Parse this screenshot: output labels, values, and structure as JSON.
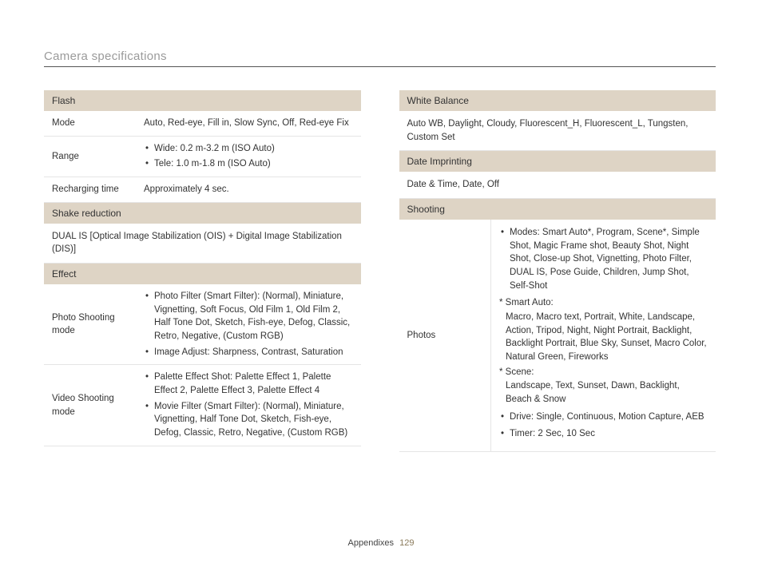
{
  "header": {
    "title": "Camera specifications",
    "footer": {
      "label": "Appendixes",
      "page": "129"
    }
  },
  "left": {
    "sec_flash": "Flash",
    "flash_rows": {
      "mode": {
        "label": "Mode",
        "value": "Auto, Red-eye, Fill in, Slow Sync, Off, Red-eye Fix"
      },
      "range": {
        "label": "Range",
        "wide": "Wide: 0.2 m-3.2 m (ISO Auto)",
        "tele": "Tele: 1.0 m-1.8 m (ISO Auto)"
      },
      "recharge": {
        "label": "Recharging time",
        "value": "Approximately 4 sec."
      }
    },
    "sec_shake": "Shake reduction",
    "shake_value": "DUAL IS [Optical Image Stabilization (OIS) + Digital Image Stabilization (DIS)]",
    "sec_effect": "Effect",
    "effect": {
      "photo": {
        "label": "Photo Shooting mode",
        "li1": "Photo Filter (Smart Filter): (Normal), Miniature, Vignetting, Soft Focus, Old Film 1, Old Film 2, Half Tone Dot, Sketch, Fish-eye, Defog, Classic, Retro, Negative, (Custom RGB)",
        "li2": "Image Adjust: Sharpness, Contrast, Saturation"
      },
      "video": {
        "label": "Video Shooting mode",
        "li1": "Palette Effect Shot: Palette Effect 1, Palette Effect 2, Palette Effect 3, Palette Effect 4",
        "li2": "Movie Filter (Smart Filter): (Normal), Miniature, Vignetting, Half Tone Dot, Sketch, Fish-eye, Defog, Classic, Retro, Negative, (Custom RGB)"
      }
    }
  },
  "right": {
    "sec_wb": "White Balance",
    "wb_value": "Auto WB, Daylight, Cloudy, Fluorescent_H, Fluorescent_L, Tungsten, Custom Set",
    "sec_date": "Date Imprinting",
    "date_value": "Date & Time, Date, Off",
    "sec_shooting": "Shooting",
    "shooting": {
      "photos": {
        "label": "Photos",
        "modes": "Modes: Smart Auto*, Program, Scene*, Simple Shot, Magic Frame shot, Beauty Shot, Night Shot, Close-up Shot, Vignetting, Photo Filter, DUAL IS, Pose Guide, Children, Jump Shot, Self-Shot",
        "sa_label": "* Smart Auto:",
        "sa_body": "Macro, Macro text, Portrait, White, Landscape, Action, Tripod, Night, Night Portrait, Backlight, Backlight Portrait, Blue Sky, Sunset, Macro Color, Natural Green, Fireworks",
        "sc_label": "* Scene:",
        "sc_body": "Landscape, Text, Sunset, Dawn, Backlight, Beach & Snow",
        "drive": "Drive: Single, Continuous, Motion Capture, AEB",
        "timer": "Timer: 2 Sec, 10 Sec"
      }
    }
  }
}
